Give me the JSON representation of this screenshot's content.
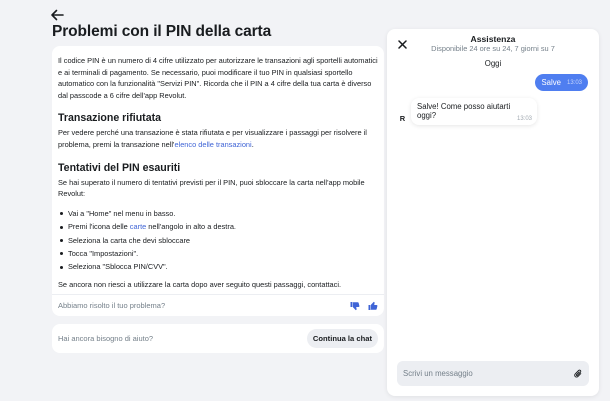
{
  "article": {
    "title": "Problemi con il PIN della carta",
    "intro": "Il codice PIN è un numero di 4 cifre utilizzato per autorizzare le transazioni agli sportelli automatici e ai terminali di pagamento. Se necessario, puoi modificare il tuo PIN in qualsiasi sportello automatico con la funzionalità \"Servizi PIN\". Ricorda che il PIN a 4 cifre della tua carta è diverso dal passcode a 6 cifre dell'app Revolut.",
    "section1": {
      "heading": "Transazione rifiutata",
      "text_before": "Per vedere perché una transazione è stata rifiutata e per visualizzare i passaggi per risolvere il problema, premi la transazione nell'",
      "link": "elenco delle transazioni",
      "text_after": "."
    },
    "section2": {
      "heading": "Tentativi del PIN esauriti",
      "text": "Se hai superato il numero di tentativi previsti per il PIN, puoi sbloccare la carta nell'app mobile Revolut:",
      "steps": [
        "Vai a \"Home\" nel menu in basso.",
        "Tocca \"Impostazioni\".",
        "Seleziona \"Sblocca PIN/CVV\"."
      ],
      "step2_before": "Premi l'icona delle ",
      "step2_link": "carte",
      "step2_after": " nell'angolo in alto a destra.",
      "step3": "Seleziona la carta che devi sbloccare",
      "closing": "Se ancora non riesci a utilizzare la carta dopo aver seguito questi passaggi, contattaci."
    },
    "feedback_question": "Abbiamo risolto il tuo problema?"
  },
  "help": {
    "question": "Hai ancora bisogno di aiuto?",
    "button": "Continua la chat"
  },
  "chat": {
    "title": "Assistenza",
    "subtitle": "Disponibile 24 ore su 24, 7 giorni su 7",
    "date_label": "Oggi",
    "outgoing": {
      "text": "Salve",
      "time": "13:03"
    },
    "incoming": {
      "text": "Salve! Come posso aiutarti oggi?",
      "time": "13:03",
      "avatar": "R"
    },
    "input_placeholder": "Scrivi un messaggio"
  },
  "colors": {
    "accent": "#4f7ef0",
    "link": "#3f64d6",
    "background": "#f2f3f6"
  },
  "icons": [
    "back-arrow-icon",
    "thumbs-down-icon",
    "thumbs-up-icon",
    "close-icon",
    "paperclip-icon"
  ]
}
